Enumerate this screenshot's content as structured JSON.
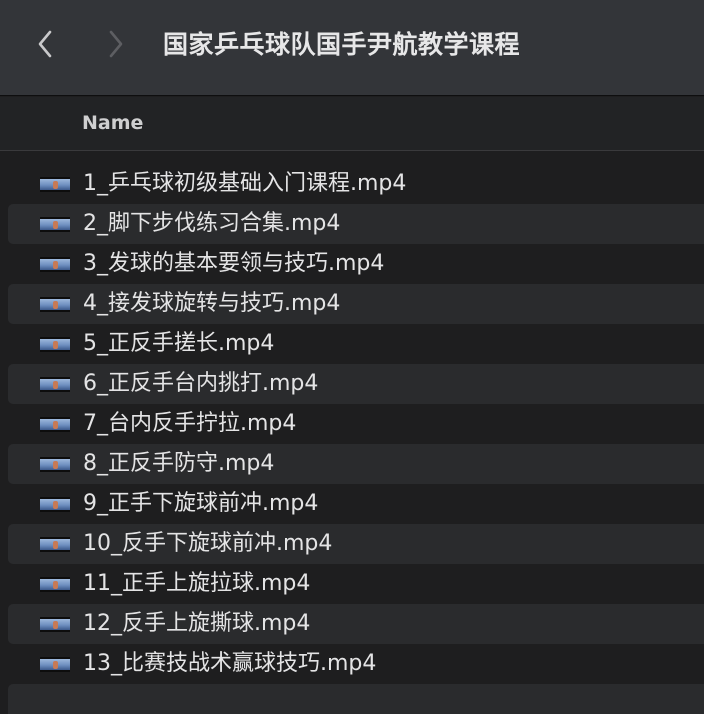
{
  "toolbar": {
    "title": "国家乒乓球队国手尹航教学课程",
    "back_icon": "chevron-left-icon",
    "forward_icon": "chevron-right-icon"
  },
  "header": {
    "name_column": "Name"
  },
  "files": [
    {
      "name": "1_乒乓球初级基础入门课程.mp4"
    },
    {
      "name": "2_脚下步伐练习合集.mp4"
    },
    {
      "name": "3_发球的基本要领与技巧.mp4"
    },
    {
      "name": "4_接发球旋转与技巧.mp4"
    },
    {
      "name": "5_正反手搓长.mp4"
    },
    {
      "name": "6_正反手台内挑打.mp4"
    },
    {
      "name": "7_台内反手拧拉.mp4"
    },
    {
      "name": "8_正反手防守.mp4"
    },
    {
      "name": "9_正手下旋球前冲.mp4"
    },
    {
      "name": "10_反手下旋球前冲.mp4"
    },
    {
      "name": "11_正手上旋拉球.mp4"
    },
    {
      "name": "12_反手上旋撕球.mp4"
    },
    {
      "name": "13_比赛技战术赢球技巧.mp4"
    }
  ]
}
